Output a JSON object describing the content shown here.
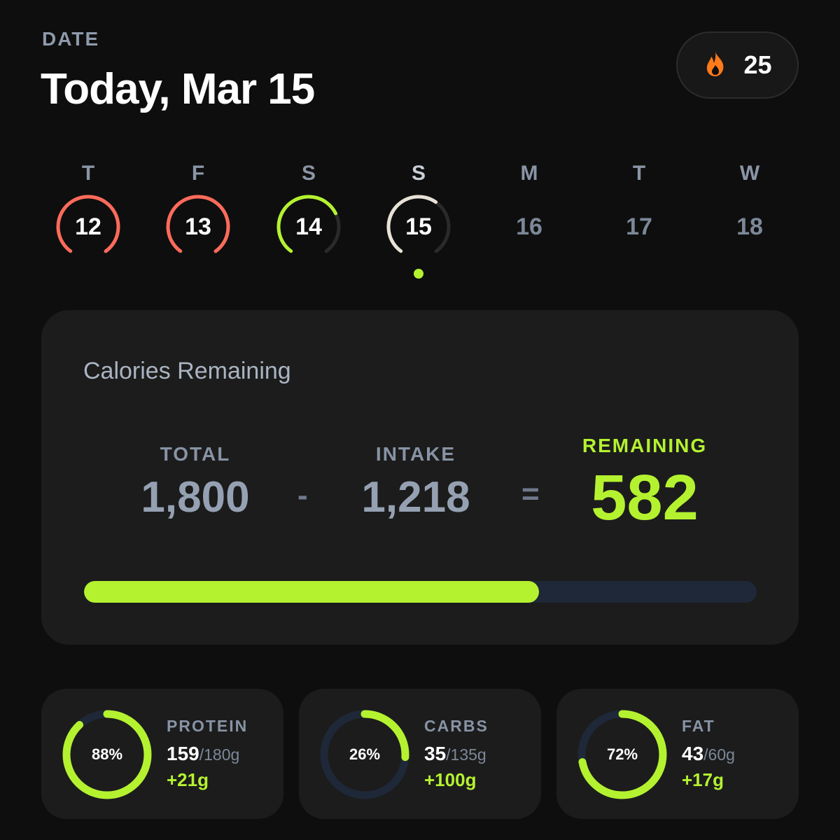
{
  "header": {
    "date_label": "DATE",
    "date_title": "Today, Mar 15",
    "streak": {
      "icon": "flame-icon",
      "count": "25",
      "icon_color": "#ff7a1a"
    }
  },
  "week": [
    {
      "letter": "T",
      "day": "12",
      "status": "over",
      "ring_color": "#ff6b5b",
      "progress": 1.0
    },
    {
      "letter": "F",
      "day": "13",
      "status": "over",
      "ring_color": "#ff6b5b",
      "progress": 1.0
    },
    {
      "letter": "S",
      "day": "14",
      "status": "partial",
      "ring_color": "#b4f230",
      "progress": 0.72
    },
    {
      "letter": "S",
      "day": "15",
      "status": "today",
      "ring_color": "#e8e2d6",
      "progress": 0.62
    },
    {
      "letter": "M",
      "day": "16",
      "status": "future"
    },
    {
      "letter": "T",
      "day": "17",
      "status": "future"
    },
    {
      "letter": "W",
      "day": "18",
      "status": "future"
    }
  ],
  "calories": {
    "title": "Calories Remaining",
    "total_label": "TOTAL",
    "total_value": "1,800",
    "minus": "-",
    "intake_label": "INTAKE",
    "intake_value": "1,218",
    "equals": "=",
    "remaining_label": "REMAINING",
    "remaining_value": "582",
    "progress_fraction": 0.676
  },
  "macros": [
    {
      "name": "PROTEIN",
      "percent": "88%",
      "fraction": 0.88,
      "amount": "159",
      "goal": "/180g",
      "left": "+21g"
    },
    {
      "name": "CARBS",
      "percent": "26%",
      "fraction": 0.26,
      "amount": "35",
      "goal": "/135g",
      "left": "+100g"
    },
    {
      "name": "FAT",
      "percent": "72%",
      "fraction": 0.72,
      "amount": "43",
      "goal": "/60g",
      "left": "+17g"
    }
  ],
  "colors": {
    "accent": "#b4f230",
    "over": "#ff6b5b",
    "track": "#1f2838",
    "background": "#0e0e0e",
    "card": "#1c1c1c"
  }
}
